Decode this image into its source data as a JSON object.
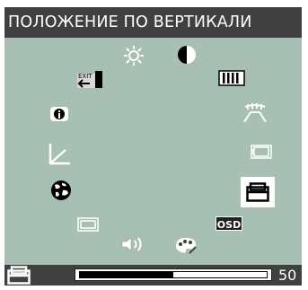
{
  "header": {
    "title": "ПОЛОЖЕНИЕ ПО ВЕРТИКАЛИ"
  },
  "menu": {
    "selected_item": "vertical-position",
    "exit_label": "EXIT",
    "osd_label": "OSD"
  },
  "value_bar": {
    "value": "50",
    "fraction": 0.5
  },
  "colors": {
    "menu_background": "#a8c0b4",
    "bar_background": "#404040",
    "text": "#ffffff"
  }
}
